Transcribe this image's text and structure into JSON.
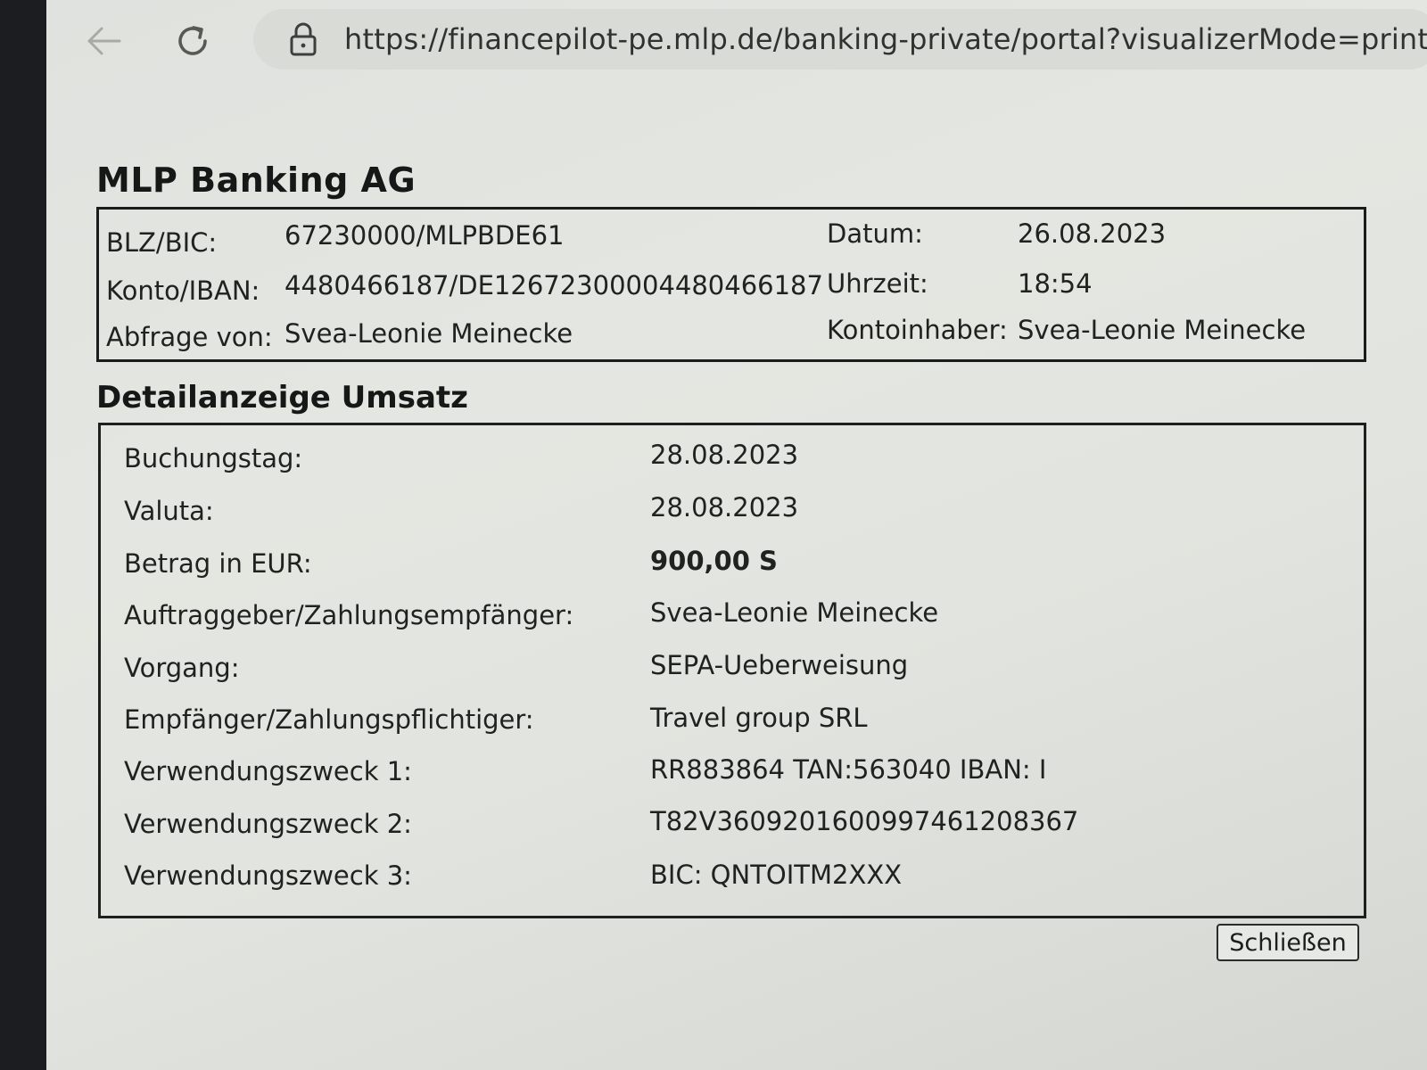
{
  "browser": {
    "url": "https://financepilot-pe.mlp.de/banking-private/portal?visualizerMode=print&tok"
  },
  "bank": {
    "name": "MLP Banking AG"
  },
  "account_info": {
    "blz_bic_label": "BLZ/BIC:",
    "blz_bic_value": "67230000/MLPBDE61",
    "konto_iban_label": "Konto/IBAN:",
    "konto_iban_value": "4480466187/DE12672300004480466187",
    "abfrage_label": "Abfrage von:",
    "abfrage_value": "Svea-Leonie Meinecke",
    "datum_label": "Datum:",
    "datum_value": "26.08.2023",
    "uhrzeit_label": "Uhrzeit:",
    "uhrzeit_value": "18:54",
    "kontoinhaber_label": "Kontoinhaber:",
    "kontoinhaber_value": "Svea-Leonie Meinecke"
  },
  "detail": {
    "title": "Detailanzeige Umsatz",
    "rows": [
      {
        "label": "Buchungstag:",
        "value": "28.08.2023"
      },
      {
        "label": "Valuta:",
        "value": "28.08.2023"
      },
      {
        "label": "Betrag in EUR:",
        "value": "900,00 S"
      },
      {
        "label": "Auftraggeber/Zahlungsempfänger:",
        "value": "Svea-Leonie Meinecke"
      },
      {
        "label": "Vorgang:",
        "value": "SEPA-Ueberweisung"
      },
      {
        "label": "Empfänger/Zahlungspflichtiger:",
        "value": "Travel group SRL"
      },
      {
        "label": "Verwendungszweck 1:",
        "value": "RR883864 TAN:563040 IBAN: I"
      },
      {
        "label": "Verwendungszweck 2:",
        "value": "T82V3609201600997461208367"
      },
      {
        "label": "Verwendungszweck 3:",
        "value": "BIC: QNTOITM2XXX"
      }
    ]
  },
  "buttons": {
    "close_label": "Schließen"
  },
  "icons": {
    "back": "arrow-left-icon",
    "reload": "reload-icon",
    "lock": "lock-icon"
  }
}
